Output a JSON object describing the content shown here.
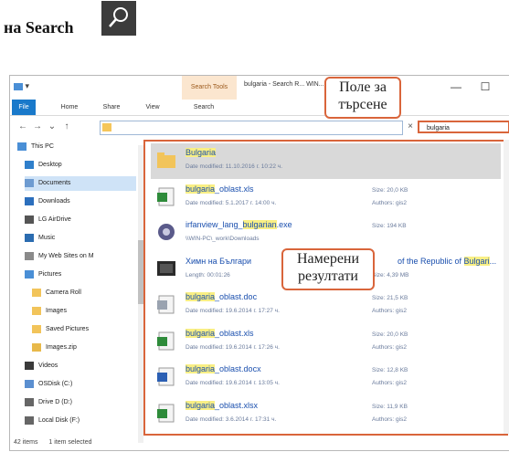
{
  "heading": {
    "prefix": "на",
    "strong": "Search"
  },
  "window": {
    "title": "bulgaria - Search R... WIN...",
    "quick_access": "▾",
    "contextual_tab": "Search Tools",
    "controls": {
      "minimize": "—",
      "maximize": "☐"
    },
    "tabs": [
      "File",
      "Home",
      "Share",
      "View",
      "Search"
    ],
    "search_value": "bulgaria",
    "address_clear": "×"
  },
  "nav": {
    "items": [
      {
        "label": "This PC",
        "icon": "computer-icon",
        "color": "#4a8fd6"
      },
      {
        "label": "Desktop",
        "icon": "desktop-icon",
        "color": "#2f7fcb"
      },
      {
        "label": "Documents",
        "icon": "documents-icon",
        "color": "#6d9bd1",
        "selected": true
      },
      {
        "label": "Downloads",
        "icon": "downloads-icon",
        "color": "#2c6fbd"
      },
      {
        "label": "LG AirDrive",
        "icon": "drive-icon",
        "color": "#555555"
      },
      {
        "label": "Music",
        "icon": "music-icon",
        "color": "#2b6cb0"
      },
      {
        "label": "My Web Sites on M",
        "icon": "web-icon",
        "color": "#8a8a8a"
      },
      {
        "label": "Pictures",
        "icon": "pictures-icon",
        "color": "#4a8fd6"
      },
      {
        "label": "Camera Roll",
        "icon": "folder-icon",
        "color": "#f2c45a"
      },
      {
        "label": "Images",
        "icon": "folder-icon",
        "color": "#f2c45a"
      },
      {
        "label": "Saved Pictures",
        "icon": "folder-icon",
        "color": "#f2c45a"
      },
      {
        "label": "Images.zip",
        "icon": "zip-folder-icon",
        "color": "#e8b94a"
      },
      {
        "label": "Videos",
        "icon": "videos-icon",
        "color": "#3a3a3a"
      },
      {
        "label": "OSDisk (C:)",
        "icon": "disk-icon",
        "color": "#5b8fd0"
      },
      {
        "label": "Drive D (D:)",
        "icon": "disk-icon",
        "color": "#666666"
      },
      {
        "label": "Local Disk (F:)",
        "icon": "disk-icon",
        "color": "#666666"
      }
    ]
  },
  "results": [
    {
      "pre": "",
      "hl": "Bulgaria",
      "post": "",
      "meta": "Date modified: 11.10.2016 г. 10:22 ч.",
      "size": "",
      "authors": "",
      "icon": "folder-icon",
      "color": "#f2c45a",
      "selected": true
    },
    {
      "pre": "",
      "hl": "bulgaria",
      "post": "_oblast.xls",
      "meta": "Date modified: 5.1.2017 г. 14:00 ч.",
      "size": "Size: 20,0 KB",
      "authors": "Authors: gis2",
      "icon": "excel-icon",
      "color": "#2e8b3a"
    },
    {
      "pre": "irfanview_lang_",
      "hl": "bulgarian",
      "post": ".exe",
      "meta": "\\\\WIN-PC\\_work\\Downloads",
      "size": "Size: 194 KB",
      "authors": "",
      "icon": "exe-icon",
      "color": "#5a5a8a"
    },
    {
      "pre": "Химн на Българи",
      "hl": "",
      "post": "",
      "tail_pre": "of the Republic of ",
      "tail_hl": "Bulgari",
      "tail_post": "...",
      "meta": "Length: 00:01:26",
      "size": "Size: 4,39 MB",
      "authors": "",
      "icon": "video-icon",
      "color": "#2a2a2a"
    },
    {
      "pre": "",
      "hl": "bulgaria",
      "post": "_oblast.doc",
      "meta": "Date modified: 19.6.2014 г. 17:27 ч.",
      "size": "Size: 21,5 KB",
      "authors": "Authors: gis2",
      "icon": "doc-icon",
      "color": "#9aa3b0"
    },
    {
      "pre": "",
      "hl": "bulgaria",
      "post": "_oblast.xls",
      "meta": "Date modified: 19.6.2014 г. 17:26 ч.",
      "size": "Size: 20,0 KB",
      "authors": "Authors: gis2",
      "icon": "excel-icon",
      "color": "#2e8b3a"
    },
    {
      "pre": "",
      "hl": "bulgaria",
      "post": "_oblast.docx",
      "meta": "Date modified: 19.6.2014 г. 13:05 ч.",
      "size": "Size: 12,8 KB",
      "authors": "Authors: gis2",
      "icon": "word-icon",
      "color": "#2b5fb3"
    },
    {
      "pre": "",
      "hl": "bulgaria",
      "post": "_oblast.xlsx",
      "meta": "Date modified: 3.6.2014 г. 17:31 ч.",
      "size": "Size: 11,9 KB",
      "authors": "Authors: gis2",
      "icon": "excel-icon",
      "color": "#2e8b3a"
    }
  ],
  "status": {
    "count": "42 items",
    "selected": "1 item selected"
  },
  "callouts": {
    "search": [
      "Поле за",
      "търсене"
    ],
    "found": [
      "Намерени",
      "резултати"
    ]
  },
  "colors": {
    "accent": "#d9653b",
    "highlight": "#f9ef84",
    "file_tab": "#1979ca"
  }
}
